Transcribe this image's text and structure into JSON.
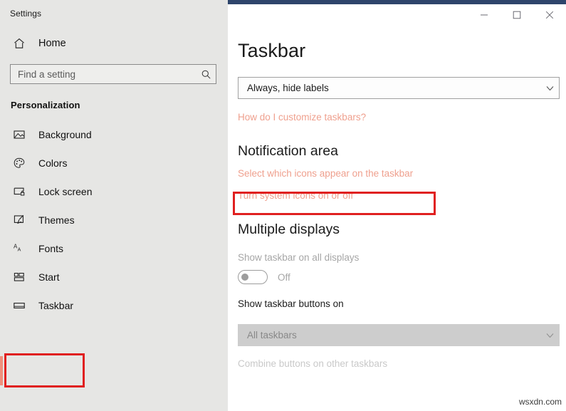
{
  "window": {
    "app_title": "Settings",
    "controls": {
      "minimize": "—",
      "maximize": "☐",
      "close": "✕"
    },
    "accent_band_color": "#2e456b"
  },
  "sidebar": {
    "home": {
      "label": "Home",
      "icon": "home-icon"
    },
    "search": {
      "placeholder": "Find a setting",
      "value": "",
      "icon": "search-icon"
    },
    "group_title": "Personalization",
    "items": [
      {
        "label": "Background",
        "icon": "picture-icon",
        "selected": false
      },
      {
        "label": "Colors",
        "icon": "palette-icon",
        "selected": false
      },
      {
        "label": "Lock screen",
        "icon": "lock-screen-icon",
        "selected": false
      },
      {
        "label": "Themes",
        "icon": "brush-icon",
        "selected": false
      },
      {
        "label": "Fonts",
        "icon": "fonts-icon",
        "selected": false
      },
      {
        "label": "Start",
        "icon": "start-tiles-icon",
        "selected": false
      },
      {
        "label": "Taskbar",
        "icon": "taskbar-icon",
        "selected": true
      }
    ],
    "selected_accent_color": "#f0907c"
  },
  "main": {
    "page_title": "Taskbar",
    "taskbar_buttons_combo": {
      "value": "Always, hide labels",
      "chevron": "⌄",
      "disabled": false
    },
    "help_link": "How do I customize taskbars?",
    "notification_area": {
      "heading": "Notification area",
      "links": [
        "Select which icons appear on the taskbar",
        "Turn system icons on or off"
      ]
    },
    "multiple_displays": {
      "heading": "Multiple displays",
      "toggle_label": "Show taskbar on all displays",
      "toggle_state": "Off",
      "buttons_label": "Show taskbar buttons on",
      "buttons_combo": {
        "value": "All taskbars",
        "chevron": "⌄",
        "disabled": true
      },
      "partial_label": "Combine buttons on other taskbars"
    }
  },
  "annotations": {
    "color": "#e02020",
    "boxes": [
      {
        "name": "taskbar-nav-highlight"
      },
      {
        "name": "select-icons-link-highlight"
      }
    ]
  },
  "watermark": "wsxdn.com"
}
